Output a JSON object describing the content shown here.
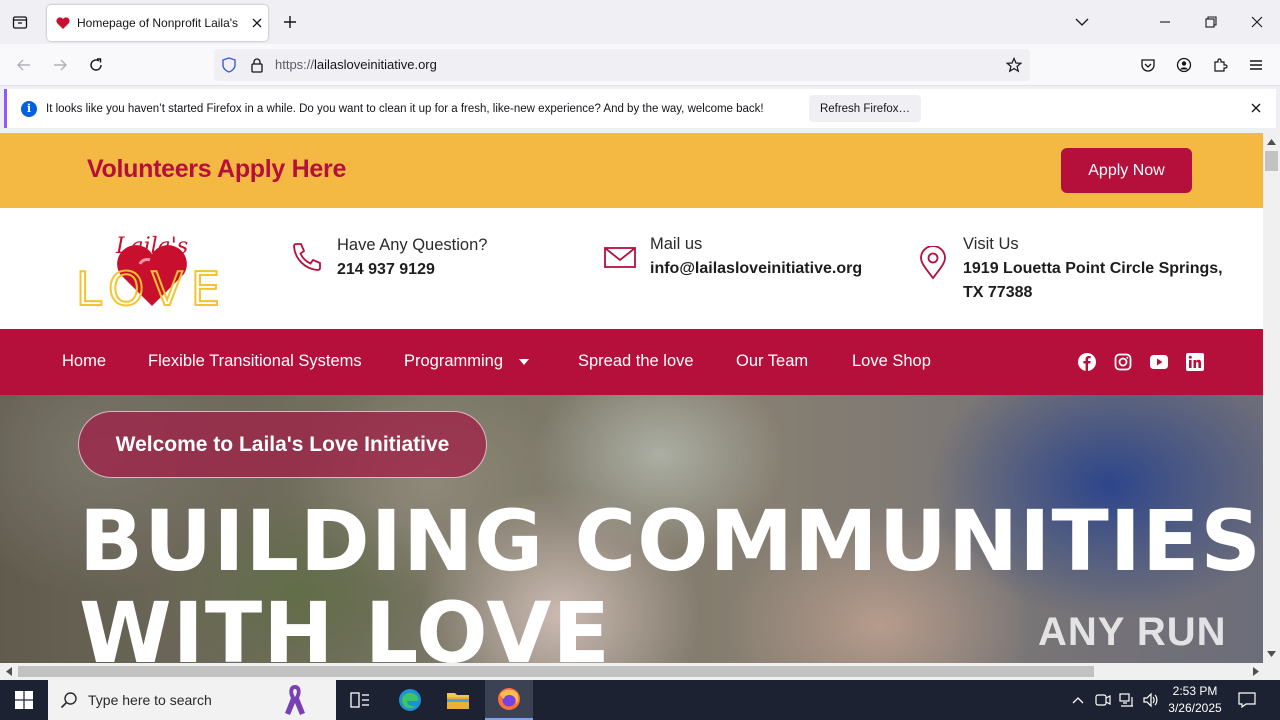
{
  "browser": {
    "tab": {
      "title": "Homepage of Nonprofit Laila's Love"
    },
    "url": {
      "protocol": "https://",
      "host": "lailasloveinitiative.org"
    },
    "notification": {
      "message": "It looks like you haven’t started Firefox in a while. Do you want to clean it up for a fresh, like-new experience? And by the way, welcome back!",
      "button_label": "Refresh Firefox…"
    }
  },
  "site": {
    "volunteer_bar": {
      "title": "Volunteers Apply Here",
      "button_label": "Apply Now"
    },
    "logo": {
      "script_text": "Laila's",
      "word": "LOVE"
    },
    "contacts": [
      {
        "heading": "Have Any Question?",
        "value": "214 937 9129",
        "icon": "phone-icon"
      },
      {
        "heading": "Mail us",
        "value": "info@lailasloveinitiative.org",
        "icon": "mail-icon"
      },
      {
        "heading": "Visit Us",
        "value_line1": "1919 Louetta Point Circle Springs,",
        "value_line2": "TX 77388",
        "icon": "location-pin-icon"
      }
    ],
    "menu": {
      "home": "Home",
      "flexible": "Flexible Transitional Systems",
      "programming": "Programming",
      "spread": "Spread the love",
      "team": "Our Team",
      "shop": "Love Shop"
    },
    "social_icons": [
      "facebook-icon",
      "instagram-icon",
      "youtube-icon",
      "linkedin-icon"
    ],
    "hero": {
      "welcome": "Welcome to Laila's Love Initiative",
      "headline_line1": "BUILDING COMMUNITIES",
      "headline_line2": "WITH LOVE"
    },
    "watermark": "ANY RUN"
  },
  "taskbar": {
    "search_placeholder": "Type here to search",
    "time": "2:53 PM",
    "date": "3/26/2025"
  },
  "colors": {
    "brand_red": "#b5103c",
    "brand_gold": "#f4b942"
  }
}
